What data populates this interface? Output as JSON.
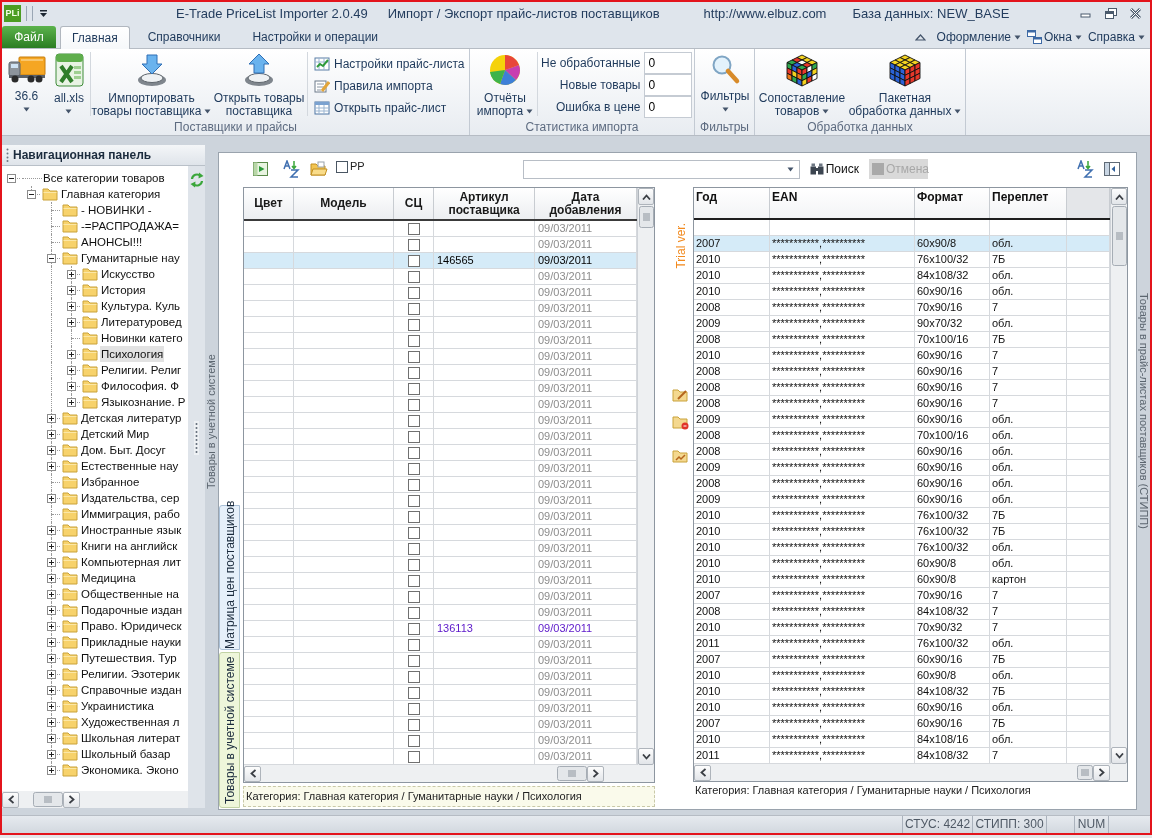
{
  "title_bar": {
    "logo": "PLi",
    "title": "E-Trade PriceList Importer 2.0.49",
    "subtitle": "Импорт / Экспорт прайс-листов поставщиков",
    "url": "http://www.elbuz.com",
    "database": "База данных: NEW_BASE"
  },
  "file_menu": {
    "label": "Файл"
  },
  "tabs": [
    {
      "label": "Главная",
      "selected": true
    },
    {
      "label": "Справочники",
      "selected": false
    },
    {
      "label": "Настройки и операции",
      "selected": false
    }
  ],
  "top_menus": [
    {
      "label": "Оформление"
    },
    {
      "label": "Окна"
    },
    {
      "label": "Справка"
    }
  ],
  "ribbon": {
    "groups": [
      {
        "label": "Поставщики и прайсы",
        "items": [
          {
            "kind": "large",
            "lines": [
              "36.6"
            ],
            "dropdown": true
          },
          {
            "kind": "large",
            "lines": [
              "all.xls"
            ],
            "dropdown": true
          },
          {
            "kind": "large",
            "lines": [
              "Импортировать",
              "товары поставщика"
            ],
            "dropdown": true
          },
          {
            "kind": "large",
            "lines": [
              "Открыть товары",
              "поставщика"
            ],
            "dropdown": false
          },
          {
            "kind": "small_stack",
            "buttons": [
              {
                "label": "Настройки прайс-листа"
              },
              {
                "label": "Правила импорта"
              },
              {
                "label": "Открыть прайс-лист"
              }
            ]
          }
        ]
      },
      {
        "label": "Статистика импорта",
        "items": [
          {
            "kind": "large",
            "lines": [
              "Отчёты",
              "импорта"
            ],
            "dropdown": true
          },
          {
            "kind": "counters",
            "fields": [
              {
                "label": "Не обработанные",
                "value": "0"
              },
              {
                "label": "Новые товары",
                "value": "0"
              },
              {
                "label": "Ошибка в цене",
                "value": "0"
              }
            ]
          }
        ]
      },
      {
        "label": "Фильтры",
        "items": [
          {
            "kind": "large",
            "lines": [
              "Фильтры"
            ],
            "dropdown": true
          }
        ]
      },
      {
        "label": "Обработка данных",
        "items": [
          {
            "kind": "large",
            "lines": [
              "Сопоставление",
              "товаров"
            ],
            "dropdown": true
          },
          {
            "kind": "large",
            "lines": [
              "Пакетная",
              "обработка данных"
            ],
            "dropdown": true
          }
        ]
      }
    ]
  },
  "navigation": {
    "title": "Навигационная панель",
    "tree": [
      {
        "label": "Все категории товаров",
        "kind": "branch",
        "expanded": true,
        "selected": false,
        "children": [
          {
            "label": "Главная категория",
            "kind": "branch",
            "expanded": true,
            "selected": false,
            "children": [
              {
                "label": "- НОВИНКИ -",
                "kind": "leaf",
                "selected": false
              },
              {
                "label": "-=РАСПРОДАЖА=",
                "kind": "leaf",
                "selected": false
              },
              {
                "label": "АНОНСЫ!!!",
                "kind": "leaf",
                "selected": false
              },
              {
                "label": "Гуманитарные нау",
                "kind": "branch",
                "expanded": true,
                "selected": false,
                "children": [
                  {
                    "label": "Искусство",
                    "kind": "branch",
                    "expanded": false,
                    "selected": false
                  },
                  {
                    "label": "История",
                    "kind": "branch",
                    "expanded": false,
                    "selected": false
                  },
                  {
                    "label": "Культура. Куль",
                    "kind": "branch",
                    "expanded": false,
                    "selected": false
                  },
                  {
                    "label": "Литературовед",
                    "kind": "branch",
                    "expanded": false,
                    "selected": false
                  },
                  {
                    "label": "Новинки катего",
                    "kind": "leaf",
                    "selected": false
                  },
                  {
                    "label": "Психология",
                    "kind": "branch",
                    "expanded": false,
                    "selected": true
                  },
                  {
                    "label": "Религии. Религ",
                    "kind": "branch",
                    "expanded": false,
                    "selected": false
                  },
                  {
                    "label": "Философия. Ф",
                    "kind": "branch",
                    "expanded": false,
                    "selected": false
                  },
                  {
                    "label": "Языкознание. Р",
                    "kind": "branch",
                    "expanded": false,
                    "selected": false
                  }
                ]
              },
              {
                "label": "Детская литератур",
                "kind": "branch",
                "expanded": false,
                "selected": false
              },
              {
                "label": "Детский Мир",
                "kind": "branch",
                "expanded": false,
                "selected": false
              },
              {
                "label": "Дом. Быт. Досуг",
                "kind": "branch",
                "expanded": false,
                "selected": false
              },
              {
                "label": "Естественные нау",
                "kind": "branch",
                "expanded": false,
                "selected": false
              },
              {
                "label": "Избранное",
                "kind": "leaf",
                "selected": false
              },
              {
                "label": "Издательства, сер",
                "kind": "branch",
                "expanded": false,
                "selected": false
              },
              {
                "label": "Иммиграция, рабо",
                "kind": "leaf",
                "selected": false
              },
              {
                "label": "Иностранные язык",
                "kind": "branch",
                "expanded": false,
                "selected": false
              },
              {
                "label": "Книги на английск",
                "kind": "branch",
                "expanded": false,
                "selected": false
              },
              {
                "label": "Компьютерная лит",
                "kind": "branch",
                "expanded": false,
                "selected": false
              },
              {
                "label": "Медицина",
                "kind": "branch",
                "expanded": false,
                "selected": false
              },
              {
                "label": "Общественные на",
                "kind": "branch",
                "expanded": false,
                "selected": false
              },
              {
                "label": "Подарочные издан",
                "kind": "branch",
                "expanded": false,
                "selected": false
              },
              {
                "label": "Право. Юридическ",
                "kind": "branch",
                "expanded": false,
                "selected": false
              },
              {
                "label": "Прикладные науки",
                "kind": "branch",
                "expanded": false,
                "selected": false
              },
              {
                "label": "Путешествия. Тур",
                "kind": "branch",
                "expanded": false,
                "selected": false
              },
              {
                "label": "Религии. Эзотерик",
                "kind": "branch",
                "expanded": false,
                "selected": false
              },
              {
                "label": "Справочные издан",
                "kind": "branch",
                "expanded": false,
                "selected": false
              },
              {
                "label": "Украинистика",
                "kind": "branch",
                "expanded": false,
                "selected": false
              },
              {
                "label": "Художественная л",
                "kind": "branch",
                "expanded": false,
                "selected": false
              },
              {
                "label": "Школьная литерат",
                "kind": "branch",
                "expanded": false,
                "selected": false
              },
              {
                "label": "Школьный базар",
                "kind": "branch",
                "expanded": false,
                "selected": false
              },
              {
                "label": "Экономика. Эконо",
                "kind": "branch",
                "expanded": false,
                "selected": false
              }
            ]
          }
        ]
      }
    ]
  },
  "dock_captions": {
    "left": "Товары в учетной системе",
    "right": "Товары в прайс-листах поставщиков (СТИПП)"
  },
  "side_tabs": [
    {
      "label": "Матрица цен поставщиков",
      "selected": true
    },
    {
      "label": "Товары в учетной системе",
      "selected": false
    }
  ],
  "toolbar": {
    "pp_checkbox": {
      "label": "PP",
      "checked": false
    },
    "search_button": {
      "label": "Поиск"
    },
    "cancel_button": {
      "label": "Отмена",
      "disabled": true
    }
  },
  "price_grid": {
    "columns": [
      "Цвет",
      "Модель",
      "СЦ",
      "Артикул поставщика",
      "Дата добавления"
    ],
    "rows": [
      {
        "date": "09/03/2011",
        "color": "#8c8c8c",
        "checked": false,
        "selected": false
      },
      {
        "date": "09/03/2011",
        "color": "#8c8c8c",
        "checked": false,
        "selected": false
      },
      {
        "article": "146565",
        "date": "09/03/2011",
        "color": "#000000",
        "checked": false,
        "selected": true
      },
      {
        "date": "09/03/2011",
        "color": "#8c8c8c",
        "checked": false,
        "selected": false
      },
      {
        "date": "09/03/2011",
        "color": "#8c8c8c",
        "checked": false,
        "selected": false
      },
      {
        "date": "09/03/2011",
        "color": "#8c8c8c",
        "checked": false,
        "selected": false
      },
      {
        "date": "09/03/2011",
        "color": "#8c8c8c",
        "checked": false,
        "selected": false
      },
      {
        "date": "09/03/2011",
        "color": "#8c8c8c",
        "checked": false,
        "selected": false
      },
      {
        "date": "09/03/2011",
        "color": "#8c8c8c",
        "checked": false,
        "selected": false
      },
      {
        "date": "09/03/2011",
        "color": "#8c8c8c",
        "checked": false,
        "selected": false
      },
      {
        "date": "09/03/2011",
        "color": "#8c8c8c",
        "checked": false,
        "selected": false
      },
      {
        "date": "09/03/2011",
        "color": "#8c8c8c",
        "checked": false,
        "selected": false
      },
      {
        "date": "09/03/2011",
        "color": "#8c8c8c",
        "checked": false,
        "selected": false
      },
      {
        "date": "09/03/2011",
        "color": "#8c8c8c",
        "checked": false,
        "selected": false
      },
      {
        "date": "09/03/2011",
        "color": "#8c8c8c",
        "checked": false,
        "selected": false
      },
      {
        "date": "09/03/2011",
        "color": "#8c8c8c",
        "checked": false,
        "selected": false
      },
      {
        "date": "09/03/2011",
        "color": "#8c8c8c",
        "checked": false,
        "selected": false
      },
      {
        "date": "09/03/2011",
        "color": "#8c8c8c",
        "checked": false,
        "selected": false
      },
      {
        "date": "09/03/2011",
        "color": "#8c8c8c",
        "checked": false,
        "selected": false
      },
      {
        "date": "09/03/2011",
        "color": "#8c8c8c",
        "checked": false,
        "selected": false
      },
      {
        "date": "09/03/2011",
        "color": "#8c8c8c",
        "checked": false,
        "selected": false
      },
      {
        "date": "09/03/2011",
        "color": "#8c8c8c",
        "checked": false,
        "selected": false
      },
      {
        "date": "09/03/2011",
        "color": "#8c8c8c",
        "checked": false,
        "selected": false
      },
      {
        "date": "09/03/2011",
        "color": "#8c8c8c",
        "checked": false,
        "selected": false
      },
      {
        "date": "09/03/2011",
        "color": "#8c8c8c",
        "checked": false,
        "selected": false
      },
      {
        "article": "136113",
        "date": "09/03/2011",
        "color": "#5b17c9",
        "checked": false,
        "selected": false
      },
      {
        "date": "09/03/2011",
        "color": "#8c8c8c",
        "checked": false,
        "selected": false
      },
      {
        "date": "09/03/2011",
        "color": "#8c8c8c",
        "checked": false,
        "selected": false
      },
      {
        "date": "09/03/2011",
        "color": "#8c8c8c",
        "checked": false,
        "selected": false
      },
      {
        "date": "09/03/2011",
        "color": "#8c8c8c",
        "checked": false,
        "selected": false
      },
      {
        "date": "09/03/2011",
        "color": "#8c8c8c",
        "checked": false,
        "selected": false
      },
      {
        "date": "09/03/2011",
        "color": "#8c8c8c",
        "checked": false,
        "selected": false
      },
      {
        "date": "09/03/2011",
        "color": "#8c8c8c",
        "checked": false,
        "selected": false
      },
      {
        "date": "09/03/2011",
        "color": "#8c8c8c",
        "checked": false,
        "selected": false
      }
    ]
  },
  "trial_label": "Trial ver.",
  "supplier_grid": {
    "columns": [
      "Год",
      "EAN",
      "Формат",
      "Переплет"
    ],
    "rows": [
      {
        "cells": [
          "2007",
          "***********,**********",
          "60x90/8",
          "обл."
        ],
        "selected": true
      },
      {
        "cells": [
          "2010",
          "***********,**********",
          "76x100/32",
          "7Б"
        ],
        "selected": false
      },
      {
        "cells": [
          "2010",
          "***********,**********",
          "84x108/32",
          "обл."
        ],
        "selected": false
      },
      {
        "cells": [
          "2010",
          "***********,**********",
          "60x90/16",
          "обл."
        ],
        "selected": false
      },
      {
        "cells": [
          "2008",
          "***********,**********",
          "70x90/16",
          "7"
        ],
        "selected": false
      },
      {
        "cells": [
          "2009",
          "***********,**********",
          "90x70/32",
          "обл."
        ],
        "selected": false
      },
      {
        "cells": [
          "2008",
          "***********,**********",
          "70x100/16",
          "7Б"
        ],
        "selected": false
      },
      {
        "cells": [
          "2010",
          "***********,**********",
          "60x90/16",
          "7"
        ],
        "selected": false
      },
      {
        "cells": [
          "2008",
          "***********,**********",
          "60x90/16",
          "7"
        ],
        "selected": false
      },
      {
        "cells": [
          "2008",
          "***********,**********",
          "60x90/16",
          "7"
        ],
        "selected": false
      },
      {
        "cells": [
          "2008",
          "***********,**********",
          "60x90/16",
          "7"
        ],
        "selected": false
      },
      {
        "cells": [
          "2009",
          "***********,**********",
          "60x90/16",
          "обл."
        ],
        "selected": false
      },
      {
        "cells": [
          "2008",
          "***********,**********",
          "70x100/16",
          "обл."
        ],
        "selected": false
      },
      {
        "cells": [
          "2008",
          "***********,**********",
          "60x90/16",
          "обл."
        ],
        "selected": false
      },
      {
        "cells": [
          "2009",
          "***********,**********",
          "60x90/16",
          "обл."
        ],
        "selected": false
      },
      {
        "cells": [
          "2008",
          "***********,**********",
          "60x90/16",
          "обл."
        ],
        "selected": false
      },
      {
        "cells": [
          "2009",
          "***********,**********",
          "60x90/16",
          "обл."
        ],
        "selected": false
      },
      {
        "cells": [
          "2010",
          "***********,**********",
          "76x100/32",
          "7Б"
        ],
        "selected": false
      },
      {
        "cells": [
          "2010",
          "***********,**********",
          "76x100/32",
          "7Б"
        ],
        "selected": false
      },
      {
        "cells": [
          "2010",
          "***********,**********",
          "76x100/32",
          "обл."
        ],
        "selected": false
      },
      {
        "cells": [
          "2010",
          "***********,**********",
          "60x90/8",
          "обл."
        ],
        "selected": false
      },
      {
        "cells": [
          "2010",
          "***********,**********",
          "60x90/8",
          "картон"
        ],
        "selected": false
      },
      {
        "cells": [
          "2007",
          "***********,**********",
          "70x90/16",
          "7"
        ],
        "selected": false
      },
      {
        "cells": [
          "2008",
          "***********,**********",
          "84x108/32",
          "7"
        ],
        "selected": false
      },
      {
        "cells": [
          "2010",
          "***********,**********",
          "70x90/32",
          "7"
        ],
        "selected": false
      },
      {
        "cells": [
          "2011",
          "***********,**********",
          "76x100/32",
          "обл."
        ],
        "selected": false
      },
      {
        "cells": [
          "2007",
          "***********,**********",
          "60x90/16",
          "7Б"
        ],
        "selected": false
      },
      {
        "cells": [
          "2010",
          "***********,**********",
          "60x90/8",
          "обл."
        ],
        "selected": false
      },
      {
        "cells": [
          "2010",
          "***********,**********",
          "84x108/32",
          "7Б"
        ],
        "selected": false
      },
      {
        "cells": [
          "2010",
          "***********,**********",
          "60x90/16",
          "обл."
        ],
        "selected": false
      },
      {
        "cells": [
          "2007",
          "***********,**********",
          "60x90/16",
          "7Б"
        ],
        "selected": false
      },
      {
        "cells": [
          "2010",
          "***********,**********",
          "84x108/16",
          "обл."
        ],
        "selected": false
      },
      {
        "cells": [
          "2011",
          "***********,**********",
          "84x108/32",
          "7"
        ],
        "selected": false
      }
    ]
  },
  "category_paths": [
    "Категория: Главная категория / Гуманитарные науки / Психология",
    "Категория: Главная категория / Гуманитарные науки / Психология"
  ],
  "status_bar": [
    "СТУС: 4242",
    "СТИПП: 300",
    "NUM"
  ]
}
